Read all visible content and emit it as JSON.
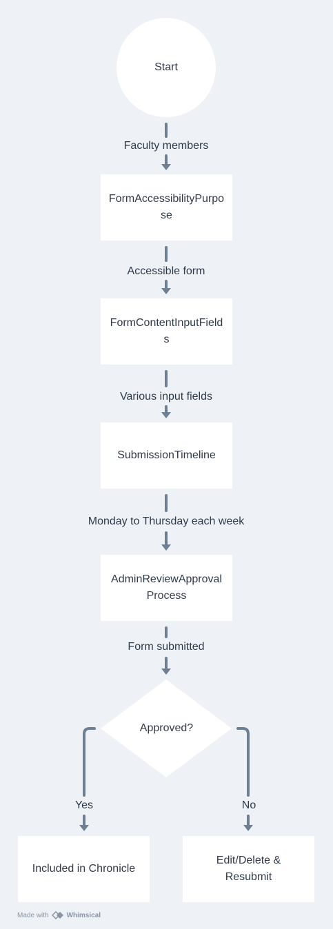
{
  "nodes": {
    "start": "Start",
    "form_accessibility": "FormAccessibilityPurpose",
    "form_content": "FormContentInputFields",
    "submission_timeline": "SubmissionTimeline",
    "admin_review": "AdminReviewApprovalProcess",
    "approved": "Approved?",
    "included": "Included in Chronicle",
    "edit_delete": "Edit/Delete & Resubmit"
  },
  "edges": {
    "faculty": "Faculty members",
    "accessible": "Accessible form",
    "various": "Various input fields",
    "monday": "Monday to Thursday each week",
    "submitted": "Form submitted",
    "yes": "Yes",
    "no": "No"
  },
  "footer": {
    "made_with": "Made with",
    "brand": "Whimsical"
  },
  "colors": {
    "background": "#eef2f6",
    "node_fill": "#ffffff",
    "connector": "#6e7f92",
    "text": "#2f3a48"
  }
}
